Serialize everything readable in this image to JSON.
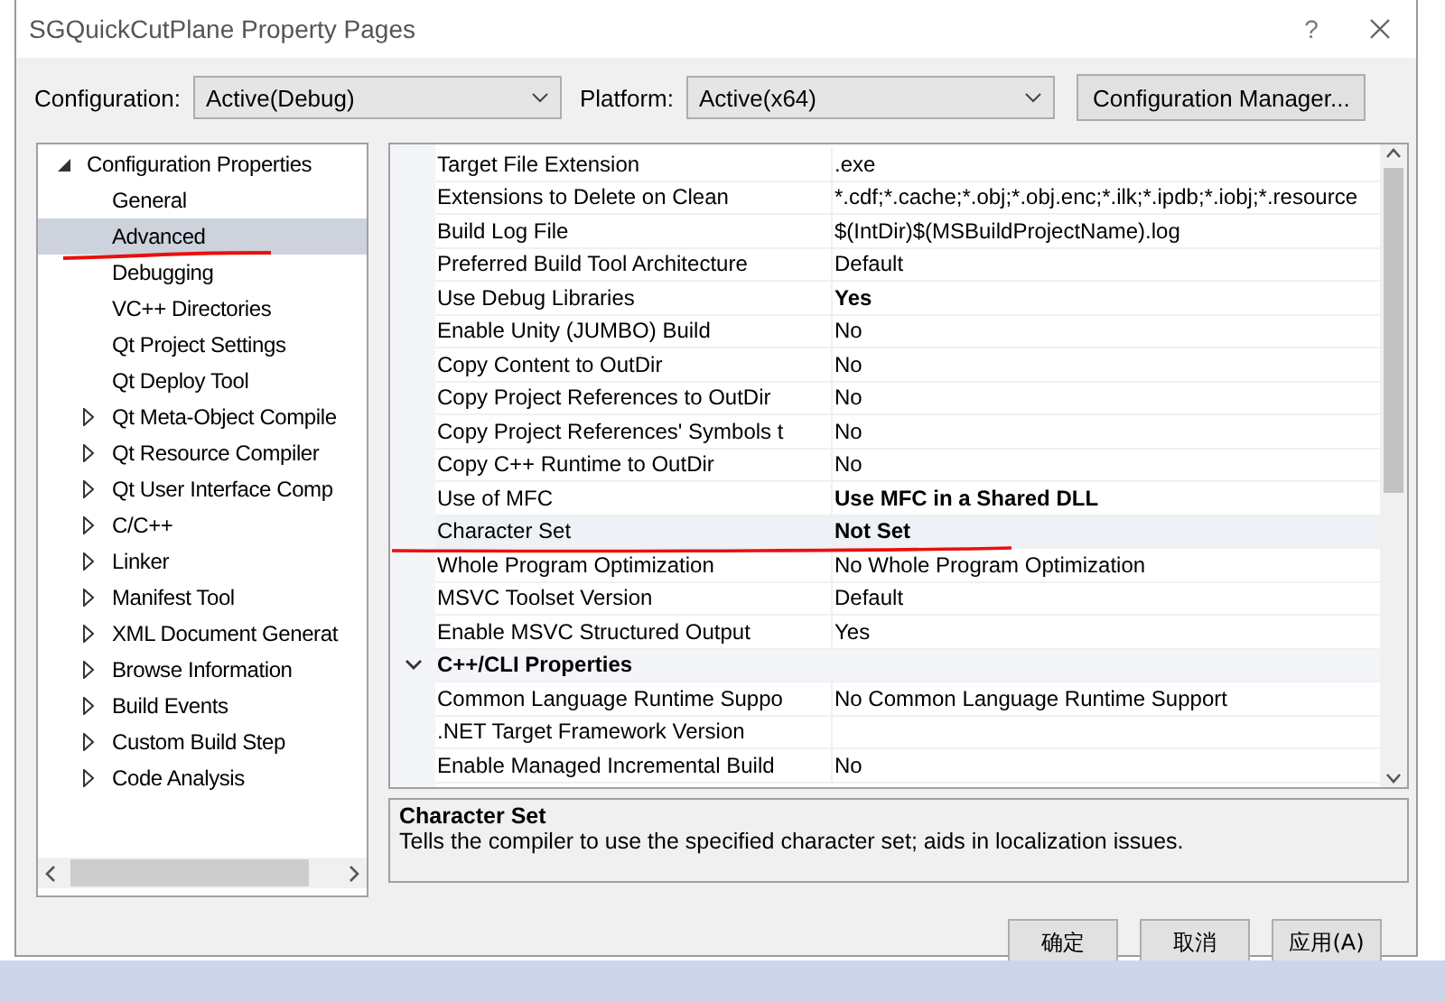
{
  "window": {
    "title": "SGQuickCutPlane Property Pages",
    "help": "?"
  },
  "configuration": {
    "label": "Configuration:",
    "value": "Active(Debug)"
  },
  "platform": {
    "label": "Platform:",
    "value": "Active(x64)"
  },
  "configuration_manager": "Configuration Manager...",
  "tree": {
    "items": [
      {
        "label": "Configuration Properties",
        "expanded": true,
        "selected": false,
        "children": [
          {
            "label": "General",
            "expandable": false,
            "selected": false
          },
          {
            "label": "Advanced",
            "expandable": false,
            "selected": true
          },
          {
            "label": "Debugging",
            "expandable": false,
            "selected": false
          },
          {
            "label": "VC++ Directories",
            "expandable": false,
            "selected": false
          },
          {
            "label": "Qt Project Settings",
            "expandable": false,
            "selected": false
          },
          {
            "label": "Qt Deploy Tool",
            "expandable": false,
            "selected": false
          },
          {
            "label": "Qt Meta-Object Compile",
            "expandable": true,
            "selected": false
          },
          {
            "label": "Qt Resource Compiler",
            "expandable": true,
            "selected": false
          },
          {
            "label": "Qt User Interface Comp",
            "expandable": true,
            "selected": false
          },
          {
            "label": "C/C++",
            "expandable": true,
            "selected": false
          },
          {
            "label": "Linker",
            "expandable": true,
            "selected": false
          },
          {
            "label": "Manifest Tool",
            "expandable": true,
            "selected": false
          },
          {
            "label": "XML Document Generat",
            "expandable": true,
            "selected": false
          },
          {
            "label": "Browse Information",
            "expandable": true,
            "selected": false
          },
          {
            "label": "Build Events",
            "expandable": true,
            "selected": false
          },
          {
            "label": "Custom Build Step",
            "expandable": true,
            "selected": false
          },
          {
            "label": "Code Analysis",
            "expandable": true,
            "selected": false
          }
        ]
      }
    ]
  },
  "grid": {
    "rows": [
      {
        "kind": "property",
        "name": "Target File Extension",
        "value": ".exe",
        "bold": false,
        "selected": false
      },
      {
        "kind": "property",
        "name": "Extensions to Delete on Clean",
        "value": "*.cdf;*.cache;*.obj;*.obj.enc;*.ilk;*.ipdb;*.iobj;*.resource",
        "bold": false,
        "selected": false
      },
      {
        "kind": "property",
        "name": "Build Log File",
        "value": "$(IntDir)$(MSBuildProjectName).log",
        "bold": false,
        "selected": false
      },
      {
        "kind": "property",
        "name": "Preferred Build Tool Architecture",
        "value": "Default",
        "bold": false,
        "selected": false
      },
      {
        "kind": "property",
        "name": "Use Debug Libraries",
        "value": "Yes",
        "bold": true,
        "selected": false
      },
      {
        "kind": "property",
        "name": "Enable Unity (JUMBO) Build",
        "value": "No",
        "bold": false,
        "selected": false
      },
      {
        "kind": "property",
        "name": "Copy Content to OutDir",
        "value": "No",
        "bold": false,
        "selected": false
      },
      {
        "kind": "property",
        "name": "Copy Project References to OutDir",
        "value": "No",
        "bold": false,
        "selected": false
      },
      {
        "kind": "property",
        "name": "Copy Project References' Symbols t",
        "value": "No",
        "bold": false,
        "selected": false
      },
      {
        "kind": "property",
        "name": "Copy C++ Runtime to OutDir",
        "value": "No",
        "bold": false,
        "selected": false
      },
      {
        "kind": "property",
        "name": "Use of MFC",
        "value": "Use MFC in a Shared DLL",
        "bold": true,
        "selected": false
      },
      {
        "kind": "property",
        "name": "Character Set",
        "value": "Not Set",
        "bold": true,
        "selected": true
      },
      {
        "kind": "property",
        "name": "Whole Program Optimization",
        "value": "No Whole Program Optimization",
        "bold": false,
        "selected": false
      },
      {
        "kind": "property",
        "name": "MSVC Toolset Version",
        "value": "Default",
        "bold": false,
        "selected": false
      },
      {
        "kind": "property",
        "name": "Enable MSVC Structured Output",
        "value": "Yes",
        "bold": false,
        "selected": false
      },
      {
        "kind": "category",
        "name": "C++/CLI Properties",
        "expanded": true
      },
      {
        "kind": "property",
        "name": "Common Language Runtime Suppo",
        "value": "No Common Language Runtime Support",
        "bold": false,
        "selected": false
      },
      {
        "kind": "property",
        "name": ".NET Target Framework Version",
        "selected": false
      },
      {
        "kind": "property",
        "name": "Enable Managed Incremental Build",
        "value": "No",
        "bold": false,
        "selected": false
      }
    ]
  },
  "description": {
    "title": "Character Set",
    "text": "Tells the compiler to use the specified character set; aids in localization issues."
  },
  "buttons": [
    "确定",
    "取消",
    "应用(A)"
  ]
}
